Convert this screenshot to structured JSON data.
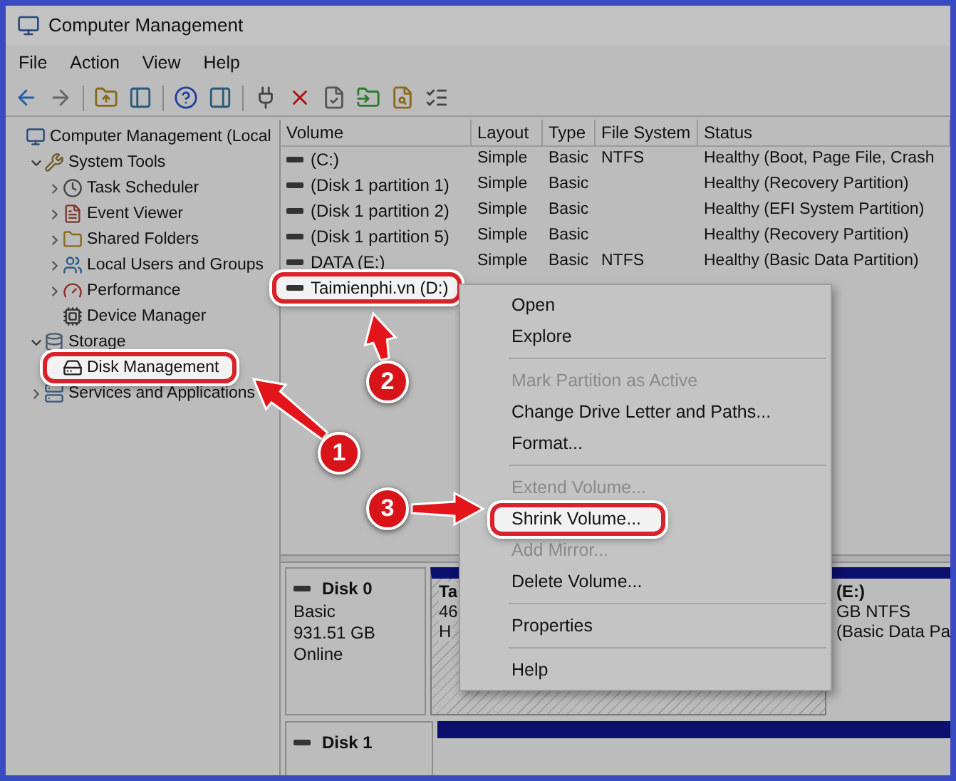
{
  "window": {
    "title": "Computer Management"
  },
  "menu_bar": [
    "File",
    "Action",
    "View",
    "Help"
  ],
  "tree": [
    {
      "label": "Computer Management (Local",
      "highlighted": false,
      "children": [
        {
          "label": "System Tools",
          "expanded": true,
          "highlighted": false,
          "children": [
            {
              "label": "Task Scheduler",
              "expanded": false,
              "highlighted": false
            },
            {
              "label": "Event Viewer",
              "expanded": false,
              "highlighted": false
            },
            {
              "label": "Shared Folders",
              "expanded": false,
              "highlighted": false
            },
            {
              "label": "Local Users and Groups",
              "expanded": false,
              "highlighted": false
            },
            {
              "label": "Performance",
              "expanded": false,
              "highlighted": false
            },
            {
              "label": "Device Manager",
              "highlighted": false
            }
          ]
        },
        {
          "label": "Storage",
          "expanded": true,
          "highlighted": false,
          "children": [
            {
              "label": "Disk Management",
              "highlighted": true
            }
          ]
        },
        {
          "label": "Services and Applications",
          "expanded": false,
          "highlighted": false
        }
      ]
    }
  ],
  "volume_table": {
    "columns": [
      "Volume",
      "Layout",
      "Type",
      "File System",
      "Status"
    ],
    "rows": [
      {
        "cells": [
          "(C:)",
          "Simple",
          "Basic",
          "NTFS",
          "Healthy (Boot, Page File, Crash"
        ],
        "highlighted": false
      },
      {
        "cells": [
          "(Disk 1 partition 1)",
          "Simple",
          "Basic",
          "",
          "Healthy (Recovery Partition)"
        ],
        "highlighted": false
      },
      {
        "cells": [
          "(Disk 1 partition 2)",
          "Simple",
          "Basic",
          "",
          "Healthy (EFI System Partition)"
        ],
        "highlighted": false
      },
      {
        "cells": [
          "(Disk 1 partition 5)",
          "Simple",
          "Basic",
          "",
          "Healthy (Recovery Partition)"
        ],
        "highlighted": false
      },
      {
        "cells": [
          "DATA (E:)",
          "Simple",
          "Basic",
          "NTFS",
          "Healthy (Basic Data Partition)"
        ],
        "highlighted": false
      },
      {
        "cells": [
          "Taimienphi.vn (D:)"
        ],
        "highlighted": true
      }
    ]
  },
  "disks": [
    {
      "name": "Disk 0",
      "lines": [
        "Basic",
        "931.51 GB",
        "Online"
      ],
      "partitions": [
        {
          "lines": [
            "Ta",
            "46",
            "H"
          ],
          "selected": true
        },
        {
          "lines": [
            "(E:)",
            "GB NTFS",
            "(Basic Data Pa"
          ],
          "selected": false
        }
      ]
    },
    {
      "name": "Disk 1"
    }
  ],
  "context_menu": {
    "items": [
      {
        "kind": "item",
        "label": "Open",
        "disabled": false,
        "highlighted": false
      },
      {
        "kind": "item",
        "label": "Explore",
        "disabled": false,
        "highlighted": false
      },
      {
        "kind": "separator"
      },
      {
        "kind": "item",
        "label": "Mark Partition as Active",
        "disabled": true,
        "highlighted": false
      },
      {
        "kind": "item",
        "label": "Change Drive Letter and Paths...",
        "disabled": false,
        "highlighted": false
      },
      {
        "kind": "item",
        "label": "Format...",
        "disabled": false,
        "highlighted": false
      },
      {
        "kind": "separator"
      },
      {
        "kind": "item",
        "label": "Extend Volume...",
        "disabled": true,
        "highlighted": false
      },
      {
        "kind": "item",
        "label": "Shrink Volume...",
        "disabled": false,
        "highlighted": true
      },
      {
        "kind": "item",
        "label": "Add Mirror...",
        "disabled": true,
        "highlighted": false
      },
      {
        "kind": "item",
        "label": "Delete Volume...",
        "disabled": false,
        "highlighted": false
      },
      {
        "kind": "separator"
      },
      {
        "kind": "item",
        "label": "Properties",
        "disabled": false,
        "highlighted": false
      },
      {
        "kind": "separator"
      },
      {
        "kind": "item",
        "label": "Help",
        "disabled": false,
        "highlighted": false
      }
    ]
  },
  "annotations": [
    {
      "number": "1"
    },
    {
      "number": "2"
    },
    {
      "number": "3"
    }
  ]
}
